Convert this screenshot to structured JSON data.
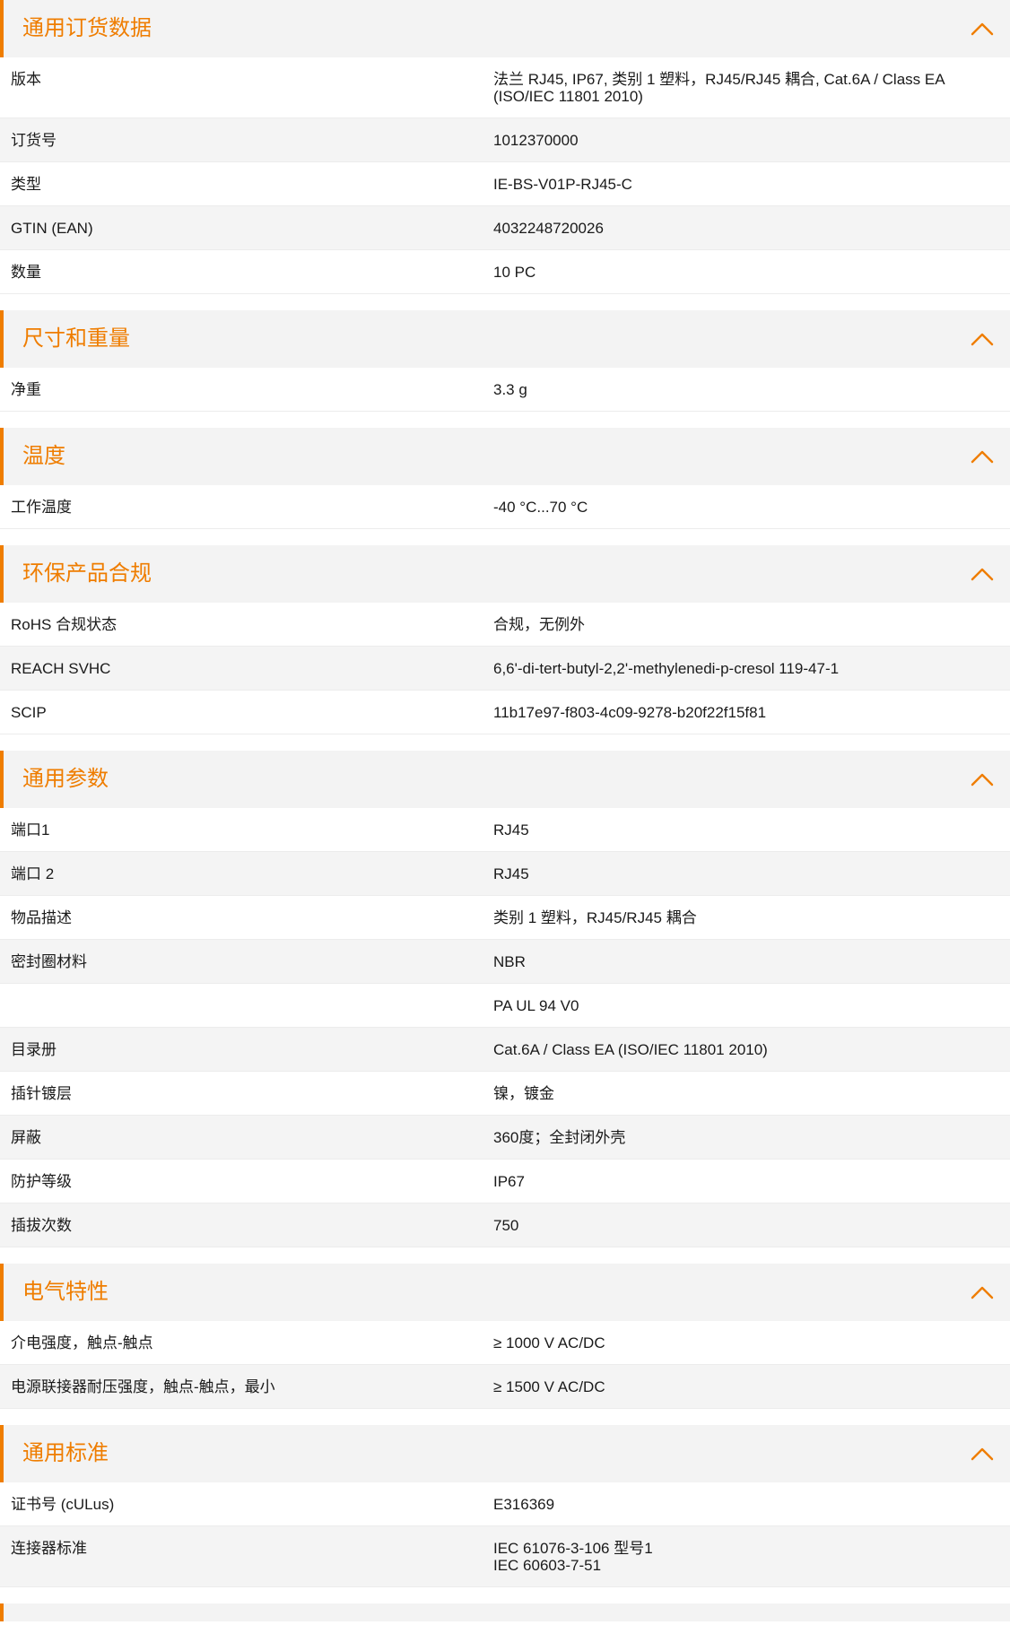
{
  "theme": {
    "accent": "#ef7d00",
    "header_bg": "#f3f3f3",
    "stripe_bg": "#f4f4f4",
    "text": "#1a1a1a"
  },
  "icons": {
    "collapse": "chevron-up-icon"
  },
  "sections": [
    {
      "id": "general-ordering",
      "title": "通用订货数据",
      "rows": [
        {
          "label": "版本",
          "value": [
            "法兰 RJ45, IP67, 类别 1 塑料，RJ45/RJ45 耦合, Cat.6A / Class EA",
            "(ISO/IEC 11801 2010)"
          ]
        },
        {
          "label": "订货号",
          "value": [
            "1012370000"
          ]
        },
        {
          "label": "类型",
          "value": [
            "IE-BS-V01P-RJ45-C"
          ]
        },
        {
          "label": "GTIN (EAN)",
          "value": [
            "4032248720026"
          ]
        },
        {
          "label": "数量",
          "value": [
            "10  PC"
          ]
        }
      ]
    },
    {
      "id": "dimensions-weight",
      "title": "尺寸和重量",
      "rows": [
        {
          "label": "净重",
          "value": [
            "3.3  g"
          ]
        }
      ]
    },
    {
      "id": "temperature",
      "title": "温度",
      "rows": [
        {
          "label": "工作温度",
          "value": [
            "-40 °C...70 °C"
          ]
        }
      ]
    },
    {
      "id": "environmental-compliance",
      "title": "环保产品合规",
      "rows": [
        {
          "label": "RoHS 合规状态",
          "value": [
            "合规，无例外"
          ]
        },
        {
          "label": "REACH SVHC",
          "value": [
            "6,6'-di-tert-butyl-2,2'-methylenedi-p-cresol 119-47-1"
          ]
        },
        {
          "label": "SCIP",
          "value": [
            "11b17e97-f803-4c09-9278-b20f22f15f81"
          ]
        }
      ]
    },
    {
      "id": "general-parameters",
      "title": "通用参数",
      "rows": [
        {
          "label": "端口1",
          "value": [
            "RJ45"
          ]
        },
        {
          "label": "端口 2",
          "value": [
            "RJ45"
          ]
        },
        {
          "label": "物品描述",
          "value": [
            "类别 1 塑料，RJ45/RJ45 耦合"
          ]
        },
        {
          "label": "密封圈材料",
          "value": [
            "NBR"
          ]
        },
        {
          "label": "",
          "value": [
            "PA UL 94 V0"
          ]
        },
        {
          "label": "目录册",
          "value": [
            "Cat.6A / Class EA (ISO/IEC 11801 2010)"
          ]
        },
        {
          "label": "插针镀层",
          "value": [
            "镍，镀金"
          ]
        },
        {
          "label": "屏蔽",
          "value": [
            "360度；全封闭外壳"
          ]
        },
        {
          "label": "防护等级",
          "value": [
            "IP67"
          ]
        },
        {
          "label": "插拔次数",
          "value": [
            "750"
          ]
        }
      ]
    },
    {
      "id": "electrical-properties",
      "title": "电气特性",
      "rows": [
        {
          "label": "介电强度，触点-触点",
          "value": [
            "≥ 1000 V AC/DC"
          ]
        },
        {
          "label": "电源联接器耐压强度，触点-触点，最小",
          "value": [
            "≥ 1500 V AC/DC"
          ]
        }
      ]
    },
    {
      "id": "general-standards",
      "title": "通用标准",
      "rows": [
        {
          "label": "证书号 (cULus)",
          "value": [
            "E316369"
          ]
        },
        {
          "label": "连接器标准",
          "value": [
            "IEC 61076-3-106 型号1",
            "IEC 60603-7-51"
          ]
        }
      ]
    }
  ]
}
